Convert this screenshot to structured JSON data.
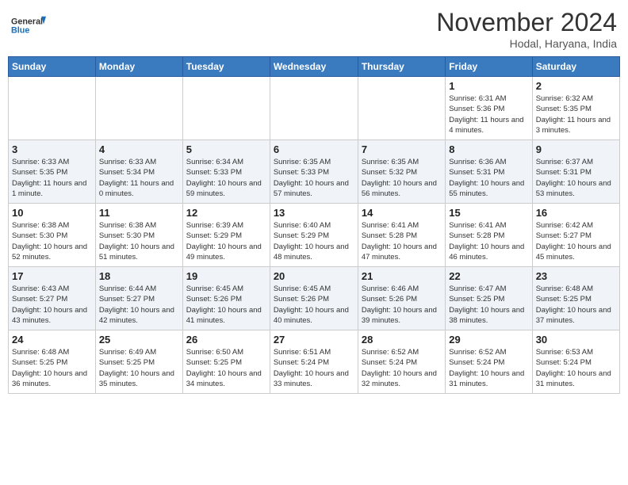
{
  "header": {
    "logo_line1": "General",
    "logo_line2": "Blue",
    "month": "November 2024",
    "location": "Hodal, Haryana, India"
  },
  "days_of_week": [
    "Sunday",
    "Monday",
    "Tuesday",
    "Wednesday",
    "Thursday",
    "Friday",
    "Saturday"
  ],
  "weeks": [
    [
      {
        "day": "",
        "info": ""
      },
      {
        "day": "",
        "info": ""
      },
      {
        "day": "",
        "info": ""
      },
      {
        "day": "",
        "info": ""
      },
      {
        "day": "",
        "info": ""
      },
      {
        "day": "1",
        "info": "Sunrise: 6:31 AM\nSunset: 5:36 PM\nDaylight: 11 hours and 4 minutes."
      },
      {
        "day": "2",
        "info": "Sunrise: 6:32 AM\nSunset: 5:35 PM\nDaylight: 11 hours and 3 minutes."
      }
    ],
    [
      {
        "day": "3",
        "info": "Sunrise: 6:33 AM\nSunset: 5:35 PM\nDaylight: 11 hours and 1 minute."
      },
      {
        "day": "4",
        "info": "Sunrise: 6:33 AM\nSunset: 5:34 PM\nDaylight: 11 hours and 0 minutes."
      },
      {
        "day": "5",
        "info": "Sunrise: 6:34 AM\nSunset: 5:33 PM\nDaylight: 10 hours and 59 minutes."
      },
      {
        "day": "6",
        "info": "Sunrise: 6:35 AM\nSunset: 5:33 PM\nDaylight: 10 hours and 57 minutes."
      },
      {
        "day": "7",
        "info": "Sunrise: 6:35 AM\nSunset: 5:32 PM\nDaylight: 10 hours and 56 minutes."
      },
      {
        "day": "8",
        "info": "Sunrise: 6:36 AM\nSunset: 5:31 PM\nDaylight: 10 hours and 55 minutes."
      },
      {
        "day": "9",
        "info": "Sunrise: 6:37 AM\nSunset: 5:31 PM\nDaylight: 10 hours and 53 minutes."
      }
    ],
    [
      {
        "day": "10",
        "info": "Sunrise: 6:38 AM\nSunset: 5:30 PM\nDaylight: 10 hours and 52 minutes."
      },
      {
        "day": "11",
        "info": "Sunrise: 6:38 AM\nSunset: 5:30 PM\nDaylight: 10 hours and 51 minutes."
      },
      {
        "day": "12",
        "info": "Sunrise: 6:39 AM\nSunset: 5:29 PM\nDaylight: 10 hours and 49 minutes."
      },
      {
        "day": "13",
        "info": "Sunrise: 6:40 AM\nSunset: 5:29 PM\nDaylight: 10 hours and 48 minutes."
      },
      {
        "day": "14",
        "info": "Sunrise: 6:41 AM\nSunset: 5:28 PM\nDaylight: 10 hours and 47 minutes."
      },
      {
        "day": "15",
        "info": "Sunrise: 6:41 AM\nSunset: 5:28 PM\nDaylight: 10 hours and 46 minutes."
      },
      {
        "day": "16",
        "info": "Sunrise: 6:42 AM\nSunset: 5:27 PM\nDaylight: 10 hours and 45 minutes."
      }
    ],
    [
      {
        "day": "17",
        "info": "Sunrise: 6:43 AM\nSunset: 5:27 PM\nDaylight: 10 hours and 43 minutes."
      },
      {
        "day": "18",
        "info": "Sunrise: 6:44 AM\nSunset: 5:27 PM\nDaylight: 10 hours and 42 minutes."
      },
      {
        "day": "19",
        "info": "Sunrise: 6:45 AM\nSunset: 5:26 PM\nDaylight: 10 hours and 41 minutes."
      },
      {
        "day": "20",
        "info": "Sunrise: 6:45 AM\nSunset: 5:26 PM\nDaylight: 10 hours and 40 minutes."
      },
      {
        "day": "21",
        "info": "Sunrise: 6:46 AM\nSunset: 5:26 PM\nDaylight: 10 hours and 39 minutes."
      },
      {
        "day": "22",
        "info": "Sunrise: 6:47 AM\nSunset: 5:25 PM\nDaylight: 10 hours and 38 minutes."
      },
      {
        "day": "23",
        "info": "Sunrise: 6:48 AM\nSunset: 5:25 PM\nDaylight: 10 hours and 37 minutes."
      }
    ],
    [
      {
        "day": "24",
        "info": "Sunrise: 6:48 AM\nSunset: 5:25 PM\nDaylight: 10 hours and 36 minutes."
      },
      {
        "day": "25",
        "info": "Sunrise: 6:49 AM\nSunset: 5:25 PM\nDaylight: 10 hours and 35 minutes."
      },
      {
        "day": "26",
        "info": "Sunrise: 6:50 AM\nSunset: 5:25 PM\nDaylight: 10 hours and 34 minutes."
      },
      {
        "day": "27",
        "info": "Sunrise: 6:51 AM\nSunset: 5:24 PM\nDaylight: 10 hours and 33 minutes."
      },
      {
        "day": "28",
        "info": "Sunrise: 6:52 AM\nSunset: 5:24 PM\nDaylight: 10 hours and 32 minutes."
      },
      {
        "day": "29",
        "info": "Sunrise: 6:52 AM\nSunset: 5:24 PM\nDaylight: 10 hours and 31 minutes."
      },
      {
        "day": "30",
        "info": "Sunrise: 6:53 AM\nSunset: 5:24 PM\nDaylight: 10 hours and 31 minutes."
      }
    ]
  ]
}
